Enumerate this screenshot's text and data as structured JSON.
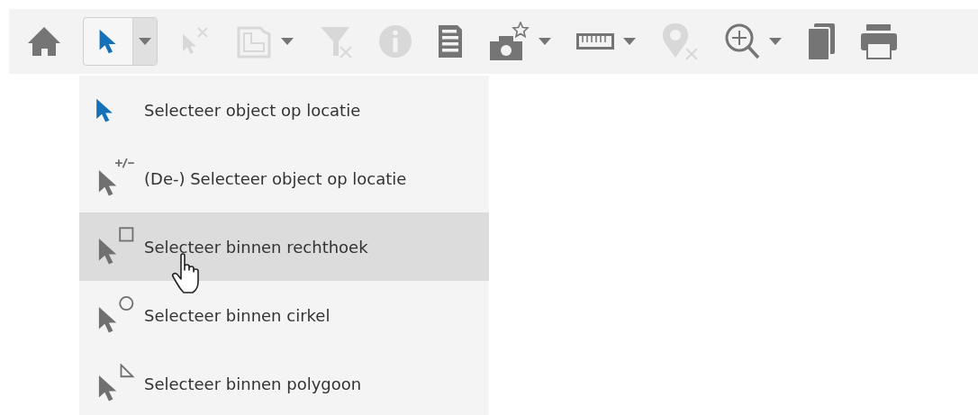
{
  "toolbar": [
    {
      "kind": "home",
      "disabled": false,
      "dropdown": false,
      "pressed": false
    },
    {
      "kind": "select",
      "disabled": false,
      "dropdown": true,
      "pressed": true
    },
    {
      "kind": "deselect",
      "disabled": true,
      "dropdown": false,
      "pressed": false
    },
    {
      "kind": "layers",
      "disabled": true,
      "dropdown": true,
      "pressed": false
    },
    {
      "kind": "filter-clear",
      "disabled": true,
      "dropdown": false,
      "pressed": false
    },
    {
      "kind": "info",
      "disabled": true,
      "dropdown": false,
      "pressed": false
    },
    {
      "kind": "document",
      "disabled": false,
      "dropdown": false,
      "pressed": false
    },
    {
      "kind": "camera",
      "disabled": false,
      "dropdown": true,
      "pressed": false
    },
    {
      "kind": "ruler",
      "disabled": false,
      "dropdown": true,
      "pressed": false
    },
    {
      "kind": "pin-clear",
      "disabled": true,
      "dropdown": false,
      "pressed": false
    },
    {
      "kind": "zoom",
      "disabled": false,
      "dropdown": true,
      "pressed": false
    },
    {
      "kind": "copy",
      "disabled": false,
      "dropdown": false,
      "pressed": false
    },
    {
      "kind": "print",
      "disabled": false,
      "dropdown": false,
      "pressed": false
    }
  ],
  "menu": [
    {
      "kind": "point",
      "label": "Selecteer object op locatie",
      "active": true,
      "selected": false
    },
    {
      "kind": "toggle",
      "label": "(De-) Selecteer object op locatie",
      "active": false,
      "selected": false
    },
    {
      "kind": "rectangle",
      "label": "Selecteer binnen rechthoek",
      "active": false,
      "selected": true
    },
    {
      "kind": "circle",
      "label": "Selecteer binnen cirkel",
      "active": false,
      "selected": false
    },
    {
      "kind": "polygon",
      "label": "Selecteer binnen polygoon",
      "active": false,
      "selected": false
    }
  ]
}
